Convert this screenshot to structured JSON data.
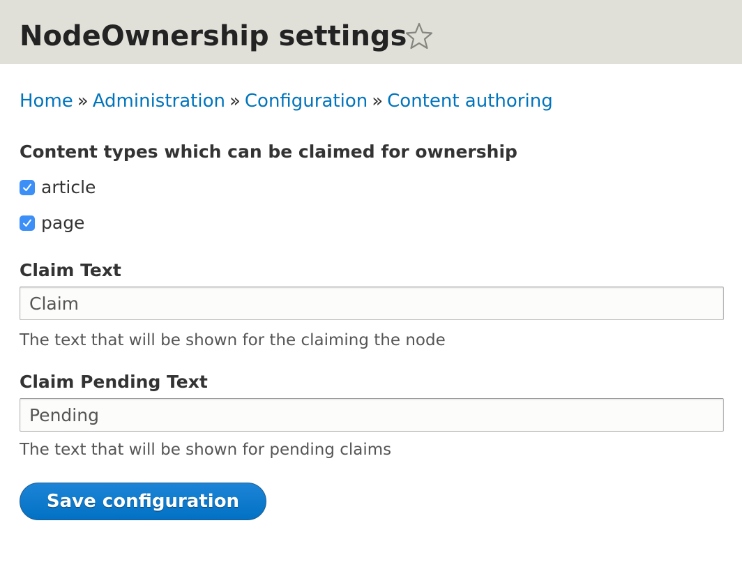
{
  "header": {
    "title": "NodeOwnership settings",
    "shortcut_icon": "star-outline-icon"
  },
  "breadcrumb": {
    "items": [
      "Home",
      "Administration",
      "Configuration",
      "Content authoring"
    ],
    "separator": "»"
  },
  "content_types": {
    "label": "Content types which can be claimed for ownership",
    "options": [
      {
        "label": "article",
        "checked": true
      },
      {
        "label": "page",
        "checked": true
      }
    ]
  },
  "claim_text": {
    "label": "Claim Text",
    "value": "Claim",
    "description": "The text that will be shown for the claiming the node"
  },
  "claim_pending_text": {
    "label": "Claim Pending Text",
    "value": "Pending",
    "description": "The text that will be shown for pending claims"
  },
  "actions": {
    "save_label": "Save configuration"
  },
  "colors": {
    "header_bg": "#e0e0d8",
    "link": "#0074bd",
    "checkbox": "#3b8ff6",
    "button": "#0271c4"
  }
}
